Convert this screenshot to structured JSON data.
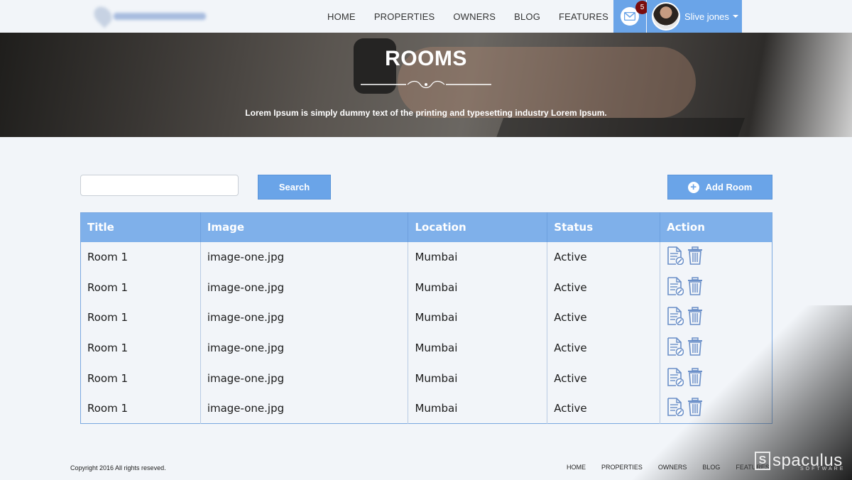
{
  "header": {
    "nav": [
      "HOME",
      "PROPERTIES",
      "OWNERS",
      "BLOG",
      "FEATURES"
    ],
    "mail_badge": "5",
    "user_name": "Slive jones"
  },
  "hero": {
    "title": "ROOMS",
    "subtitle": "Lorem Ipsum is simply dummy text of the printing and typesetting industry Lorem Ipsum."
  },
  "controls": {
    "search_value": "",
    "search_label": "Search",
    "add_label": "Add Room"
  },
  "table": {
    "columns": [
      "Title",
      "Image",
      "Location",
      "Status",
      "Action"
    ],
    "rows": [
      {
        "title": "Room 1",
        "image": "image-one.jpg",
        "location": "Mumbai",
        "status": "Active"
      },
      {
        "title": "Room 1",
        "image": "image-one.jpg",
        "location": "Mumbai",
        "status": "Active"
      },
      {
        "title": "Room 1",
        "image": "image-one.jpg",
        "location": "Mumbai",
        "status": "Active"
      },
      {
        "title": "Room 1",
        "image": "image-one.jpg",
        "location": "Mumbai",
        "status": "Active"
      },
      {
        "title": "Room 1",
        "image": "image-one.jpg",
        "location": "Mumbai",
        "status": "Active"
      },
      {
        "title": "Room 1",
        "image": "image-one.jpg",
        "location": "Mumbai",
        "status": "Active"
      }
    ],
    "action_icons": [
      "edit-document-icon",
      "trash-icon"
    ]
  },
  "footer": {
    "copyright": "Copyright 2016 All rights reseved.",
    "nav": [
      "HOME",
      "PROPERTIES",
      "OWNERS",
      "BLOG",
      "FEATURES"
    ]
  },
  "watermark": {
    "name": "spaculus",
    "tagline": "SOFTWARE"
  },
  "colors": {
    "accent": "#6aa4e8",
    "table_header": "#7fb0ea",
    "badge": "#7a0d0d",
    "background": "#f2f5f9"
  }
}
